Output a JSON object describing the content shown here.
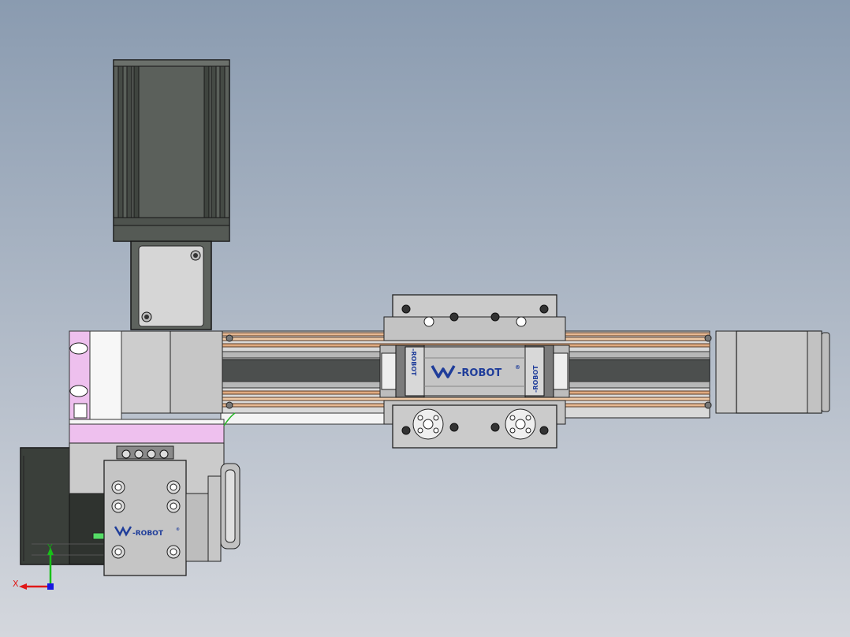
{
  "brand": {
    "rail_carriage_label": "-ROBOT",
    "lower_module_label": "-ROBOT",
    "side_label_left": "-ROBOT",
    "side_label_right": "-ROBOT",
    "registered_mark": "®"
  },
  "axis_triad": {
    "x_label": "X",
    "y_label": "Y"
  },
  "colors": {
    "background_top": "#8a9bb0",
    "background_bottom": "#d4d7dd",
    "motor_body": "#5a5f5a",
    "metal_gray": "#c4c4c4",
    "rail_copper": "#e5b48c",
    "rail_dark": "#4d504f",
    "pink_plate": "#eec0ee",
    "brand_blue": "#1f3d9a",
    "axis_red": "#e01818",
    "axis_green": "#18c018",
    "axis_blue": "#1818e0"
  }
}
